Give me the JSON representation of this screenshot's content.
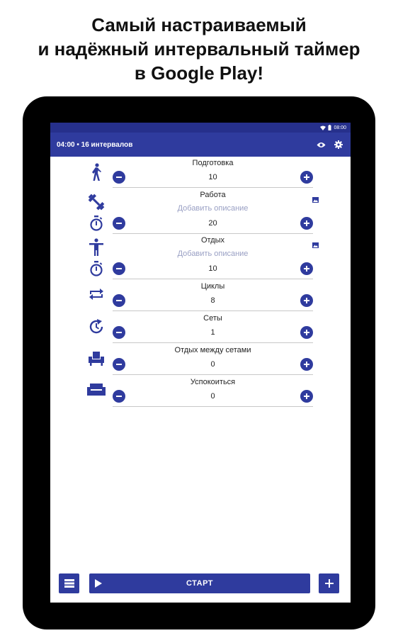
{
  "headline": {
    "line1": "Самый настраиваемый",
    "line2": "и надёжный интервальный таймер",
    "line3": "в Google Play!"
  },
  "statusbar": {
    "time": "08:00"
  },
  "appbar": {
    "title": "04:00 • 16 интервалов",
    "actions": [
      "eye-icon",
      "settings-gear-icon"
    ]
  },
  "rows": [
    {
      "label": "Подготовка",
      "value": "10",
      "icon": "walking-person-icon"
    },
    {
      "label": "Работа",
      "description": "Добавить описание",
      "value": "20",
      "icon": "dumbbell-icon",
      "value_icon": "stopwatch-icon"
    },
    {
      "label": "Отдых",
      "description": "Добавить описание",
      "value": "10",
      "icon": "standing-person-icon",
      "value_icon": "stopwatch-icon"
    },
    {
      "label": "Циклы",
      "value": "8",
      "icon": "repeat-arrows-icon"
    },
    {
      "label": "Сеты",
      "value": "1",
      "icon": "restart-clock-icon"
    },
    {
      "label": "Отдых между сетами",
      "value": "0",
      "icon": "armchair-icon"
    },
    {
      "label": "Успокоиться",
      "value": "0",
      "icon": "sofa-icon"
    }
  ],
  "bottombar": {
    "start_label": "СТАРТ",
    "left_icon": "list-menu-icon",
    "right_icon": "plus-icon"
  },
  "colors": {
    "primary": "#2f3b9e",
    "statusbar": "#26308c",
    "hint": "#9aa0c4"
  }
}
